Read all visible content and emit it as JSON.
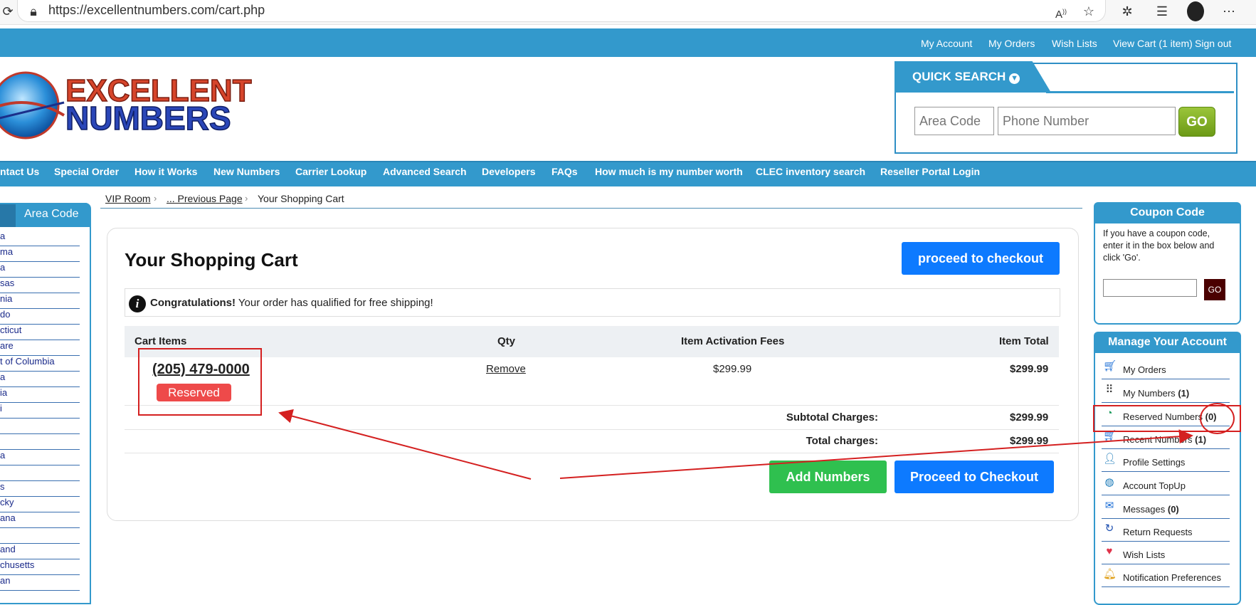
{
  "browser": {
    "url": "https://excellentnumbers.com/cart.php"
  },
  "topnav": [
    "My Account",
    "My Orders",
    "Wish Lists",
    "View Cart (1 item)",
    "Sign out"
  ],
  "logo": {
    "line1": "EXCELLENT",
    "line2": "NUMBERS"
  },
  "quick_search": {
    "title": "QUICK SEARCH",
    "area_code_placeholder": "Area Code",
    "phone_placeholder": "Phone Number",
    "go_label": "GO"
  },
  "mainnav": [
    "ntact Us",
    "Special Order",
    "How it Works",
    "New Numbers",
    "Carrier Lookup",
    "Advanced Search",
    "Developers",
    "FAQs",
    "How much is my number worth",
    "CLEC inventory search",
    "Reseller Portal Login"
  ],
  "left_sidebar": {
    "tab_label": "Area Code",
    "items": [
      "a",
      "ma",
      "a",
      "sas",
      "nia",
      "do",
      "cticut",
      "are",
      "t of Columbia",
      "a",
      "ia",
      "i",
      "",
      "",
      "a",
      "",
      "s",
      "cky",
      "ana",
      "",
      "and",
      "chusetts",
      "an"
    ]
  },
  "breadcrumb": [
    "VIP Room",
    "... Previous Page",
    "Your Shopping Cart"
  ],
  "cart": {
    "title": "Your Shopping Cart",
    "checkout_top": "proceed to checkout",
    "notice_bold": "Congratulations!",
    "notice_text": " Your order has qualified for free shipping!",
    "headers": {
      "items": "Cart Items",
      "qty": "Qty",
      "fees": "Item Activation Fees",
      "total": "Item Total"
    },
    "item": {
      "number": "(205) 479-0000",
      "status": "Reserved",
      "remove": "Remove",
      "fee": "$299.99",
      "total": "$299.99"
    },
    "subtotal_label": "Subtotal Charges:",
    "subtotal_value": "$299.99",
    "total_label": "Total charges:",
    "total_value": "$299.99",
    "add_numbers": "Add Numbers",
    "checkout_bottom": "Proceed to Checkout"
  },
  "coupon": {
    "title": "Coupon Code",
    "text": "If you have a coupon code, enter it in the box below and click 'Go'.",
    "go": "GO"
  },
  "account": {
    "title": "Manage Your Account",
    "items": [
      {
        "label": "My Orders",
        "count": "",
        "icon": "cart-icon"
      },
      {
        "label": "My Numbers",
        "count": "(1)",
        "icon": "keypad-icon"
      },
      {
        "label": "Reserved Numbers",
        "count": "(0)",
        "icon": "clock-phone-icon"
      },
      {
        "label": "Recent Numbers",
        "count": "(1)",
        "icon": "recent-cart-icon"
      },
      {
        "label": "Profile Settings",
        "count": "",
        "icon": "user-icon"
      },
      {
        "label": "Account TopUp",
        "count": "",
        "icon": "chart-icon"
      },
      {
        "label": "Messages",
        "count": "(0)",
        "icon": "message-icon"
      },
      {
        "label": "Return Requests",
        "count": "",
        "icon": "return-icon"
      },
      {
        "label": "Wish Lists",
        "count": "",
        "icon": "heart-icon"
      },
      {
        "label": "Notification Preferences",
        "count": "",
        "icon": "bell-icon"
      }
    ]
  },
  "colors": {
    "brand_blue": "#3399cc",
    "button_blue": "#0d7aff",
    "green": "#2fc04f",
    "reserved_red": "#ee4a4a",
    "annotation_red": "#d42020"
  }
}
